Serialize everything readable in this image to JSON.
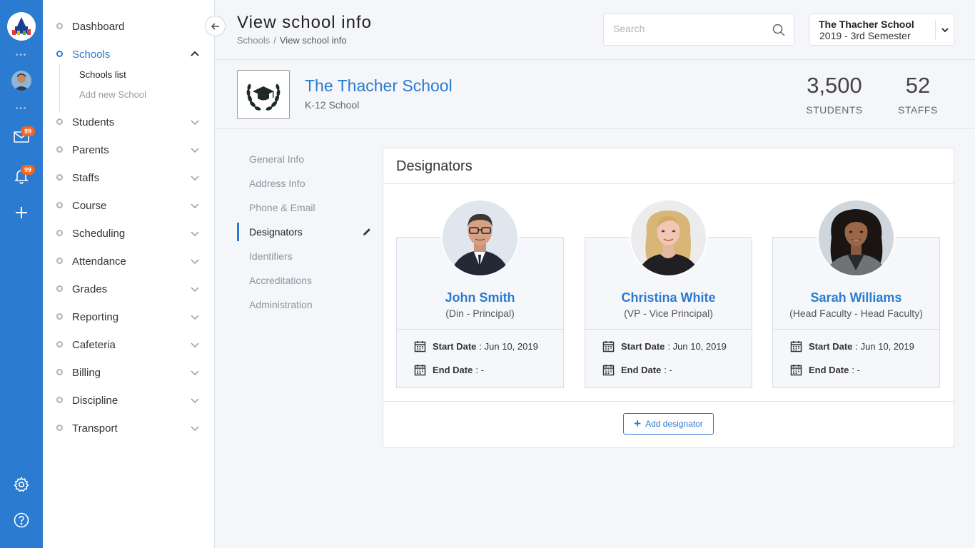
{
  "rail": {
    "mail_badge": "99",
    "notify_badge": "99"
  },
  "sidebar": {
    "items": [
      {
        "label": "Dashboard"
      },
      {
        "label": "Schools"
      },
      {
        "label": "Students"
      },
      {
        "label": "Parents"
      },
      {
        "label": "Staffs"
      },
      {
        "label": "Course"
      },
      {
        "label": "Scheduling"
      },
      {
        "label": "Attendance"
      },
      {
        "label": "Grades"
      },
      {
        "label": "Reporting"
      },
      {
        "label": "Cafeteria"
      },
      {
        "label": "Billing"
      },
      {
        "label": "Discipline"
      },
      {
        "label": "Transport"
      }
    ],
    "sub_items": [
      {
        "label": "Schools list"
      },
      {
        "label": "Add new School"
      }
    ]
  },
  "header": {
    "title": "View school info",
    "breadcrumb": [
      "Schools",
      "View school info"
    ],
    "breadcrumb_sep": "/",
    "search_placeholder": "Search",
    "school_select": {
      "name": "The Thacher School",
      "term": "2019 - 3rd Semester"
    }
  },
  "school": {
    "name": "The Thacher School",
    "type": "K-12 School",
    "stats": [
      {
        "value": "3,500",
        "label": "STUDENTS"
      },
      {
        "value": "52",
        "label": "STAFFS"
      }
    ]
  },
  "tabs": [
    {
      "label": "General Info"
    },
    {
      "label": "Address Info"
    },
    {
      "label": "Phone & Email"
    },
    {
      "label": "Designators"
    },
    {
      "label": "Identifiers"
    },
    {
      "label": "Accreditations"
    },
    {
      "label": "Administration"
    }
  ],
  "designators": {
    "title": "Designators",
    "start_label": "Start Date",
    "end_label": "End Date",
    "add_button": "Add designator",
    "people": [
      {
        "name": "John Smith",
        "role": "(Din - Principal)",
        "start": ": Jun 10, 2019",
        "end": ": -"
      },
      {
        "name": "Christina White",
        "role": "(VP - Vice Principal)",
        "start": ": Jun 10, 2019",
        "end": ": -"
      },
      {
        "name": "Sarah Williams",
        "role": "(Head Faculty - Head Faculty)",
        "start": ": Jun 10, 2019",
        "end": ": -"
      }
    ]
  },
  "colors": {
    "primary": "#2b7bd0",
    "badge": "#f26522"
  }
}
